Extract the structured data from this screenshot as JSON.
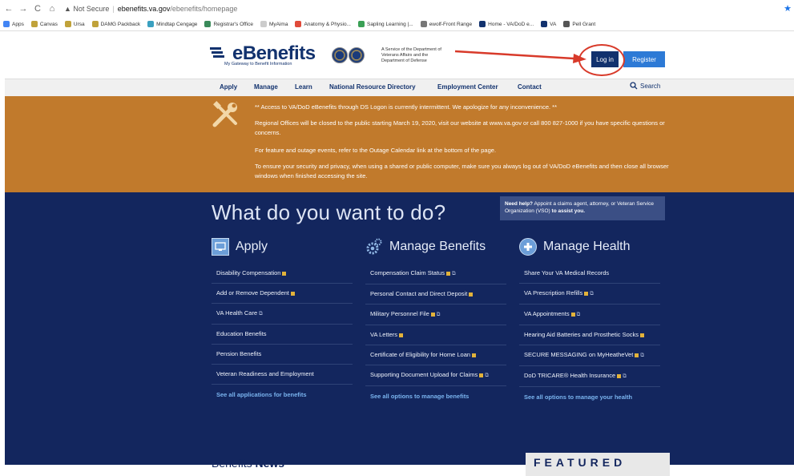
{
  "browser": {
    "nav": [
      "←",
      "→",
      "C",
      "⌂"
    ],
    "security": "▲ Not Secure",
    "host": "ebenefits.va.gov",
    "path": "/ebenefits/homepage",
    "bookmarks": [
      {
        "label": "Apps",
        "color": "#4285f4"
      },
      {
        "label": "Canvas",
        "color": "#c0a23a"
      },
      {
        "label": "Ursa",
        "color": "#c0a23a"
      },
      {
        "label": "DAMG Packback",
        "color": "#c0a23a"
      },
      {
        "label": "Mindtap Cengage",
        "color": "#3aa0c0"
      },
      {
        "label": "Registrar's Office",
        "color": "#3a8a5a"
      },
      {
        "label": "MyAima",
        "color": "#cccccc"
      },
      {
        "label": "Anatomy & Physio...",
        "color": "#e04b3a"
      },
      {
        "label": "Sapling Learning |...",
        "color": "#3aa055"
      },
      {
        "label": "ewolf-Front Range",
        "color": "#777777"
      },
      {
        "label": "Home - VA/DoD e...",
        "color": "#12326e"
      },
      {
        "label": "VA",
        "color": "#12326e"
      },
      {
        "label": "Pell Grant",
        "color": "#555555"
      }
    ]
  },
  "header": {
    "logo_text": "eBenefits",
    "logo_tagline": "My Gateway to Benefit Information",
    "service_text": "A Service of the Department of Veterans Affairs and the Department of Defense",
    "login_label": "Log in",
    "register_label": "Register"
  },
  "nav": {
    "items": [
      "Apply",
      "Manage",
      "Learn",
      "National Resource Directory",
      "Employment Center",
      "Contact"
    ],
    "search_label": "Search"
  },
  "alert": {
    "lines": [
      "** Access to VA/DoD eBenefits through DS Logon is currently intermittent. We apologize for any inconvenience. **",
      "Regional Offices will be closed to the public starting March 19, 2020, visit our website at www.va.gov or call 800 827-1000 if you have specific questions or concerns.",
      "For feature and outage events, refer to the Outage Calendar link at the bottom of the page.",
      "To ensure your security and privacy, when using a shared or public computer, make sure you always log out of VA/DoD eBenefits and then close all browser windows when finished accessing the site."
    ]
  },
  "main": {
    "heading": "What do you want to do?",
    "help_bold": "Need help?",
    "help_text": " Appoint a claims agent, attorney, or Veteran Service Organization (VSO) ",
    "help_link": "to assist you.",
    "columns": [
      {
        "title": "Apply",
        "links": [
          "Disability Compensation",
          "Add or Remove Dependent",
          "VA Health Care",
          "Education Benefits",
          "Pension Benefits",
          "Veteran Readiness and Employment"
        ],
        "see_all": "See all applications for benefits"
      },
      {
        "title": "Manage Benefits",
        "links": [
          "Compensation Claim Status",
          "Personal Contact and Direct Deposit",
          "Military Personnel File",
          "VA Letters",
          "Certificate of Eligibility for Home Loan",
          "Supporting Document Upload for Claims"
        ],
        "see_all": "See all options to manage benefits"
      },
      {
        "title": "Manage Health",
        "links": [
          "Share Your VA Medical Records",
          "VA Prescription Refills",
          "VA Appointments",
          "Hearing Aid Batteries and Prosthetic Socks",
          "SECURE MESSAGING on MyHeatheVet",
          "DoD TRICARE® Health Insurance"
        ],
        "see_all": "See all options to manage your health"
      }
    ]
  },
  "bottom": {
    "news_prefix": "Benefits ",
    "news_bold": "News",
    "featured": "FEATURED"
  },
  "colors": {
    "navy": "#13265e",
    "alert_orange": "#c17a2c",
    "login_bg": "#12326e",
    "register_bg": "#2d7ad6",
    "circle_red": "#d83a2a"
  }
}
